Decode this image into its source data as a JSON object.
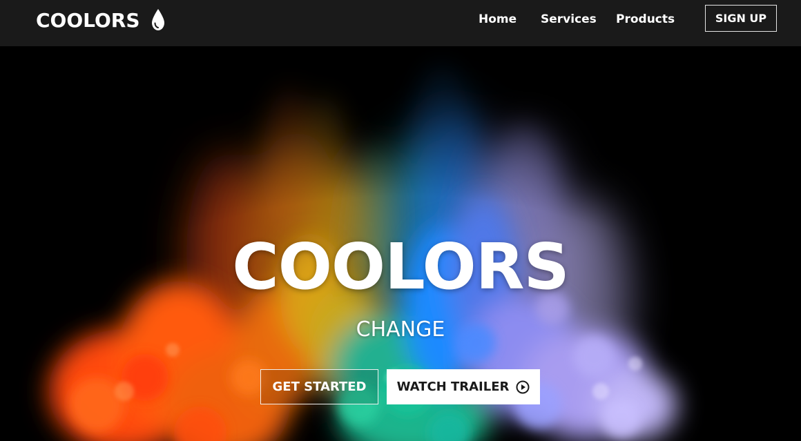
{
  "header": {
    "brand": "COOLORS",
    "brand_icon": "water-drop-icon",
    "nav": {
      "home": "Home",
      "services": "Services",
      "products": "Products"
    },
    "signup_label": "SIGN UP"
  },
  "hero": {
    "title": "COOLORS",
    "subtitle": "CHANGE",
    "get_started_label": "GET STARTED",
    "watch_trailer_label": "WATCH TRAILER",
    "watch_trailer_icon": "play-circle-icon"
  },
  "colors": {
    "navbar": "#1a1a1a",
    "background": "#000000",
    "text": "#ffffff",
    "button_light": "#ffffff"
  }
}
